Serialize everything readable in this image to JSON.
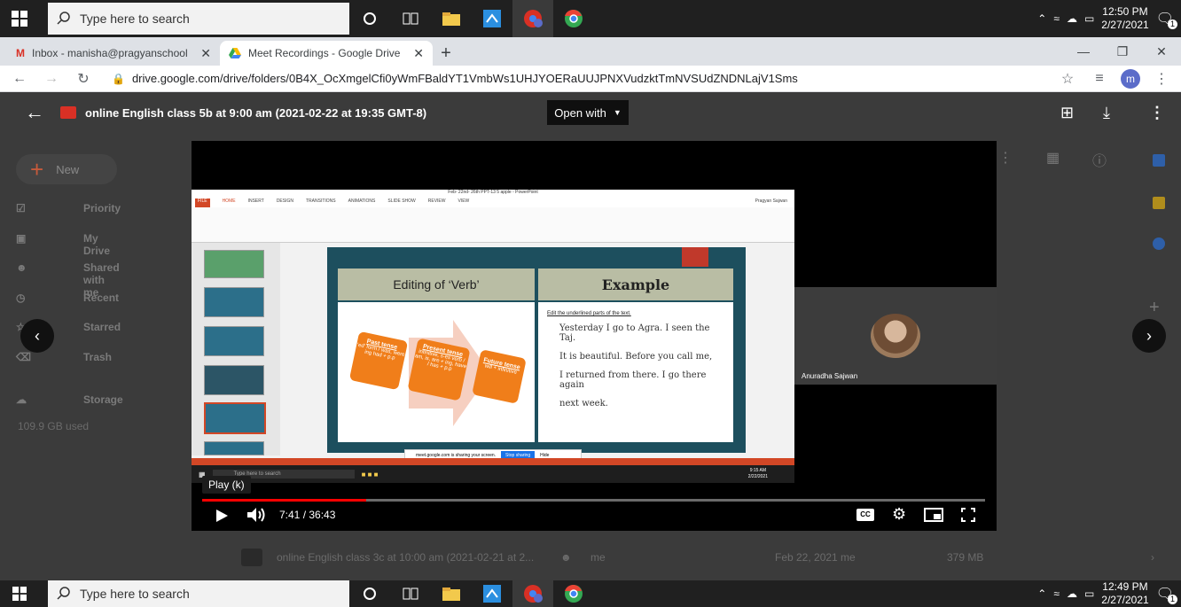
{
  "taskbar": {
    "search_placeholder": "Type here to search",
    "clock_top": {
      "time": "12:50 PM",
      "date": "2/27/2021"
    },
    "clock_bottom": {
      "time": "12:49 PM",
      "date": "2/27/2021"
    },
    "notif_count": "1"
  },
  "browser": {
    "tabs": [
      {
        "title": "Inbox - manisha@pragyanschool",
        "icon": "gmail-icon",
        "active": false
      },
      {
        "title": "Meet Recordings - Google Drive",
        "icon": "drive-icon",
        "active": true
      }
    ],
    "url": "drive.google.com/drive/folders/0B4X_OcXmgelCfi0yWmFBaldYT1VmbWs1UHJYOERaUUJPNXVudzktTmNVSUdZNDNLajV1Sms",
    "profile_initial": "m"
  },
  "preview": {
    "title": "online English class 5b at 9:00 am (2021-02-22 at 19:35 GMT-8)",
    "open_with": "Open with"
  },
  "drive_sidebar": {
    "new_label": "New",
    "items": [
      "Priority",
      "My Drive",
      "Shared with me",
      "Recent",
      "Starred",
      "Trash",
      "Storage"
    ],
    "storage_used": "109.9 GB used"
  },
  "drive_row": {
    "name": "online English class 3c at 10:00 am (2021-02-21 at 2...",
    "owner": "me",
    "modified": "Feb 22, 2021 me",
    "size": "379 MB"
  },
  "player": {
    "tooltip": "Play (k)",
    "current_time": "7:41",
    "duration": "36:43",
    "time_display": "7:41 / 36:43",
    "progress_fraction": 0.209,
    "participant_name": "Anuradha Sajwan"
  },
  "slide": {
    "ppt_title": "Feb- 22nd- 26th PPT-13 5 apple - PowerPoint",
    "left_header": "Editing of ‘Verb’",
    "right_header": "Example",
    "instruction": "Edit the underlined parts of the text.",
    "lines": [
      "Yesterday I go to Agra. I seen the Taj.",
      "It is beautiful. Before you call me,",
      "I returned from there. I go there again",
      "next week."
    ],
    "boxes": [
      {
        "title": "Past tense",
        "body": "‘ed’ form / was, were ing had + p.p"
      },
      {
        "title": "Present tense",
        "body": "infinitive, s-es verb / am, is, are + ing, have / has + p.p"
      },
      {
        "title": "Future tense",
        "body": "will + infinitive"
      }
    ],
    "sharing_msg": "meet.google.com is sharing your screen.",
    "stop_sharing": "Stop sharing",
    "hide": "Hide",
    "inner_search": "Type here to search",
    "inner_time": "9:15 AM",
    "inner_date": "2/22/2021",
    "ribbon_tabs": [
      "FILE",
      "HOME",
      "INSERT",
      "DESIGN",
      "TRANSITIONS",
      "ANIMATIONS",
      "SLIDE SHOW",
      "REVIEW",
      "VIEW"
    ],
    "ppt_user": "Pragyan Sajwan"
  },
  "colors": {
    "accent_orange": "#f07e1a",
    "progress_red": "#ff0000",
    "slide_teal": "#1d4f5e",
    "header_gray": "#b9bda4"
  }
}
